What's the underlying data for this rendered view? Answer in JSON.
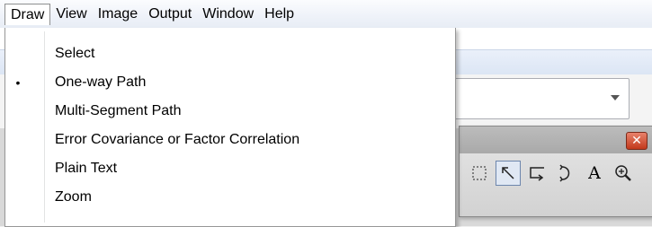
{
  "menubar": {
    "items": [
      {
        "label": "Draw",
        "open": true
      },
      {
        "label": "View"
      },
      {
        "label": "Image"
      },
      {
        "label": "Output"
      },
      {
        "label": "Window"
      },
      {
        "label": "Help"
      }
    ]
  },
  "draw_menu": {
    "items": [
      {
        "label": "Select",
        "checked": false
      },
      {
        "label": "One-way Path",
        "checked": true,
        "bullet": "•"
      },
      {
        "label": "Multi-Segment Path",
        "checked": false
      },
      {
        "label": "Error Covariance or Factor Correlation",
        "checked": false
      },
      {
        "label": "Plain Text",
        "checked": false
      },
      {
        "label": "Zoom",
        "checked": false
      }
    ]
  },
  "tool_window": {
    "close_glyph": "✕",
    "tools": [
      {
        "name": "marquee-select-icon",
        "selected": false
      },
      {
        "name": "arrow-pointer-icon",
        "selected": true
      },
      {
        "name": "multi-segment-path-icon",
        "selected": false
      },
      {
        "name": "covariance-curve-icon",
        "selected": false
      },
      {
        "name": "text-tool-icon",
        "selected": false,
        "glyph": "A"
      },
      {
        "name": "zoom-icon",
        "selected": false
      }
    ]
  },
  "colors": {
    "close_button": "#c2391c",
    "tool_selected": "#e0e8f4"
  }
}
